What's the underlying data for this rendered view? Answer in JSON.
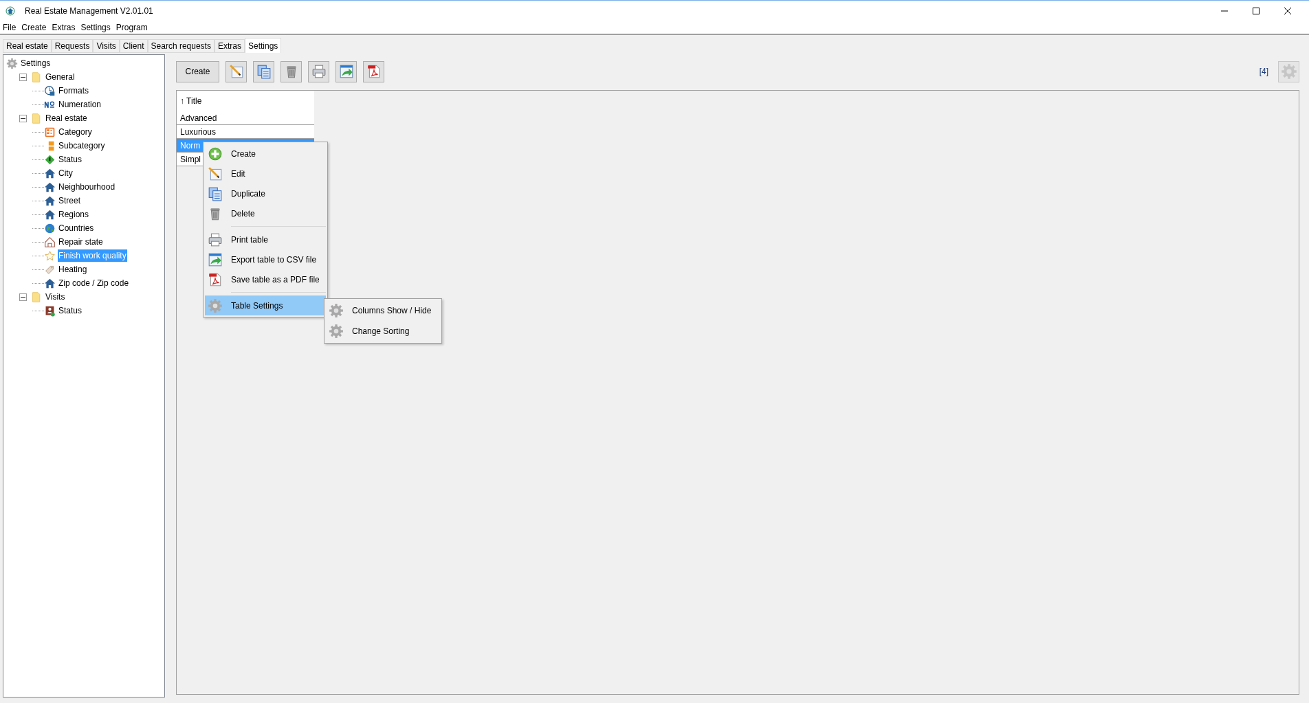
{
  "window": {
    "title": "Real Estate Management V2.01.01"
  },
  "menu_bar": [
    "File",
    "Create",
    "Extras",
    "Settings",
    "Program"
  ],
  "tabs": [
    {
      "label": "Real estate",
      "selected": false
    },
    {
      "label": "Requests",
      "selected": false
    },
    {
      "label": "Visits",
      "selected": false
    },
    {
      "label": "Client",
      "selected": false
    },
    {
      "label": "Search requests",
      "selected": false
    },
    {
      "label": "Extras",
      "selected": false
    },
    {
      "label": "Settings",
      "selected": true
    }
  ],
  "tree": {
    "label": "Settings",
    "kind": "gear",
    "children": [
      {
        "label": "General",
        "kind": "folder",
        "expanded": true,
        "selected": false,
        "children": [
          {
            "label": "Formats",
            "kind": "clock",
            "selected": false
          },
          {
            "label": "Numeration",
            "kind": "number",
            "selected": false
          }
        ]
      },
      {
        "label": "Real estate",
        "kind": "folder",
        "expanded": true,
        "selected": false,
        "children": [
          {
            "label": "Category",
            "kind": "category",
            "selected": false
          },
          {
            "label": "Subcategory",
            "kind": "subcategory",
            "selected": false
          },
          {
            "label": "Status",
            "kind": "diamond",
            "selected": false
          },
          {
            "label": "City",
            "kind": "house",
            "selected": false
          },
          {
            "label": "Neighbourhood",
            "kind": "house",
            "selected": false
          },
          {
            "label": "Street",
            "kind": "house",
            "selected": false
          },
          {
            "label": "Regions",
            "kind": "house",
            "selected": false
          },
          {
            "label": "Countries",
            "kind": "globe",
            "selected": false
          },
          {
            "label": "Repair state",
            "kind": "outline-house",
            "selected": false
          },
          {
            "label": "Finish work quality",
            "kind": "star",
            "selected": true
          },
          {
            "label": "Heating",
            "kind": "tag",
            "selected": false
          },
          {
            "label": "Zip code / Zip code",
            "kind": "house",
            "selected": false
          }
        ]
      },
      {
        "label": "Visits",
        "kind": "folder",
        "expanded": true,
        "selected": false,
        "children": [
          {
            "label": "Status",
            "kind": "visit",
            "selected": false
          }
        ]
      }
    ]
  },
  "toolbar": {
    "create_button": "Create",
    "icon_buttons": [
      {
        "kind": "edit"
      },
      {
        "kind": "duplicate"
      },
      {
        "kind": "delete"
      },
      {
        "kind": "print"
      },
      {
        "kind": "export"
      },
      {
        "kind": "pdf"
      }
    ],
    "count": "[4]",
    "settings_disabled": true
  },
  "table": {
    "columns": [
      "↑ Title"
    ],
    "rows": [
      {
        "cells": [
          "Advanced"
        ],
        "selected": false
      },
      {
        "cells": [
          "Luxurious"
        ],
        "selected": false
      },
      {
        "cells": [
          "Norm"
        ],
        "selected": true
      },
      {
        "cells": [
          "Simpl"
        ],
        "selected": false
      }
    ]
  },
  "context_menu": {
    "items": [
      {
        "kind": "create",
        "label": "Create",
        "highlighted": false
      },
      {
        "kind": "edit",
        "label": "Edit",
        "highlighted": false
      },
      {
        "kind": "duplicate",
        "label": "Duplicate",
        "highlighted": false
      },
      {
        "kind": "delete",
        "label": "Delete",
        "highlighted": false
      },
      {
        "kind": "separator"
      },
      {
        "kind": "print",
        "label": "Print table",
        "highlighted": false
      },
      {
        "kind": "export",
        "label": "Export table to CSV file",
        "highlighted": false
      },
      {
        "kind": "pdf",
        "label": "Save table as a PDF file",
        "highlighted": false
      },
      {
        "kind": "separator"
      },
      {
        "kind": "gear",
        "label": "Table Settings",
        "highlighted": true
      }
    ]
  },
  "submenu": {
    "items": [
      {
        "kind": "gear",
        "label": "Columns Show / Hide"
      },
      {
        "kind": "gear",
        "label": "Change Sorting"
      }
    ]
  }
}
